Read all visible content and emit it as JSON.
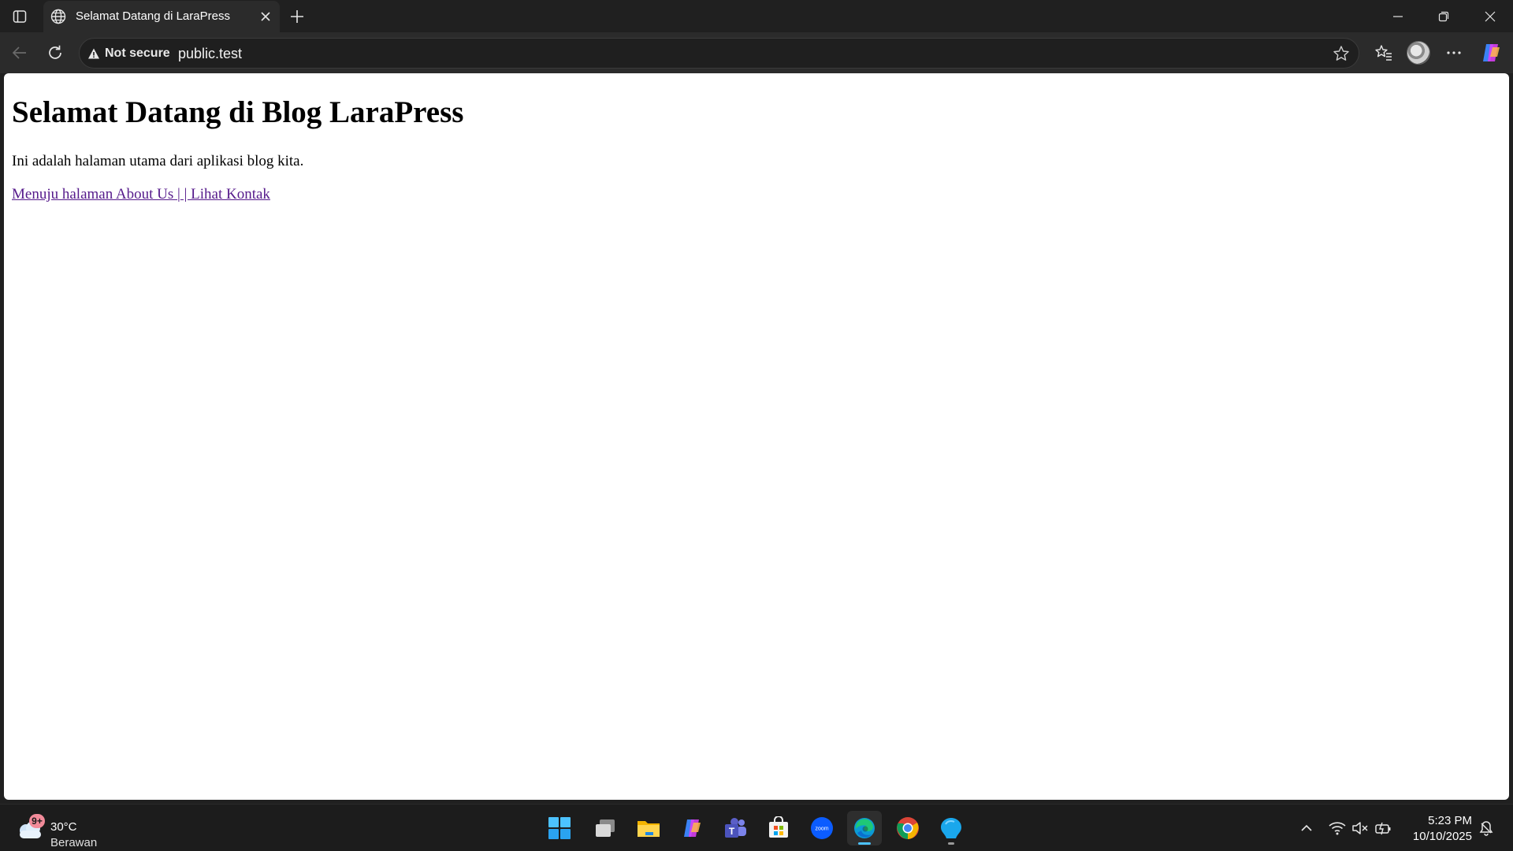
{
  "browser": {
    "tab": {
      "title": "Selamat Datang di LaraPress"
    },
    "address": {
      "security_label": "Not secure",
      "url": "public.test"
    }
  },
  "page": {
    "heading": "Selamat Datang di Blog LaraPress",
    "paragraph": "Ini adalah halaman utama dari aplikasi blog kita.",
    "links": [
      {
        "label": "Menuju halaman About Us "
      },
      {
        "label": "|"
      },
      {
        "label": " | Lihat Kontak"
      }
    ]
  },
  "taskbar": {
    "weather": {
      "badge": "9+",
      "temperature": "30°C",
      "condition": "Berawan"
    },
    "apps": [
      {
        "name": "start-icon"
      },
      {
        "name": "task-view-icon"
      },
      {
        "name": "file-explorer-icon"
      },
      {
        "name": "copilot-icon"
      },
      {
        "name": "teams-icon"
      },
      {
        "name": "microsoft-store-icon"
      },
      {
        "name": "zoom-icon",
        "label": "zoom"
      },
      {
        "name": "edge-icon"
      },
      {
        "name": "chrome-icon"
      },
      {
        "name": "app-icon"
      }
    ],
    "clock": {
      "time": "5:23 PM",
      "date": "10/10/2025"
    }
  },
  "colors": {
    "link_visited": "#551a8b",
    "accent": "#4cc2ff",
    "chrome_dark": "#202020"
  }
}
